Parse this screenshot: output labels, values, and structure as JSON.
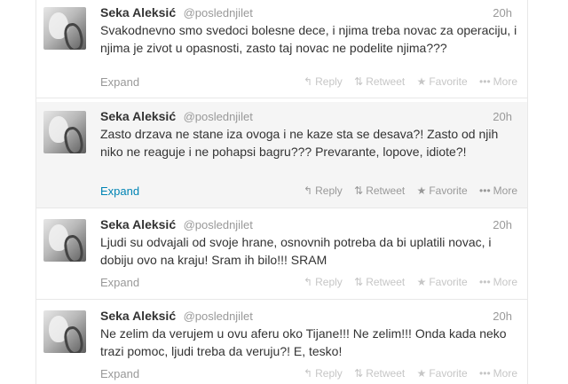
{
  "tweets": [
    {
      "name": "Seka Aleksić",
      "handle": "@poslednjilet",
      "time": "20h",
      "text": "Svakodnevno smo svedoci bolesne dece, i njima treba novac za operaciju, i njima je zivot u opasnosti, zasto taj novac ne podelite njima???",
      "expand": "Expand",
      "reply": "Reply",
      "retweet": "Retweet",
      "favorite": "Favorite",
      "more": "More"
    },
    {
      "name": "Seka Aleksić",
      "handle": "@poslednjilet",
      "time": "20h",
      "text": "Zasto drzava ne stane iza ovoga i ne kaze sta se desava?! Zasto od njih niko ne reaguje i ne pohapsi bagru??? Prevarante, lopove, idiote?!",
      "expand": "Expand",
      "reply": "Reply",
      "retweet": "Retweet",
      "favorite": "Favorite",
      "more": "More"
    },
    {
      "name": "Seka Aleksić",
      "handle": "@poslednjilet",
      "time": "20h",
      "text": "Ljudi su odvajali od svoje hrane, osnovnih potreba da bi uplatili novac, i dobiju ovo na kraju! Sram ih bilo!!! SRAM",
      "expand": "Expand",
      "reply": "Reply",
      "retweet": "Retweet",
      "favorite": "Favorite",
      "more": "More"
    },
    {
      "name": "Seka Aleksić",
      "handle": "@poslednjilet",
      "time": "20h",
      "text": "Ne zelim da verujem u ovu aferu oko Tijane!!! Ne zelim!!! Onda kada neko trazi pomoc, ljudi treba da veruju?! E, tesko!",
      "expand": "Expand",
      "reply": "Reply",
      "retweet": "Retweet",
      "favorite": "Favorite",
      "more": "More"
    }
  ],
  "icons": {
    "reply": "reply-arrow-icon",
    "retweet": "retweet-icon",
    "favorite": "star-icon",
    "more": "more-dots-icon"
  },
  "colors": {
    "link": "#0084b4",
    "hover_background": "#f5f5f5",
    "text": "#333333",
    "muted": "#999999"
  }
}
